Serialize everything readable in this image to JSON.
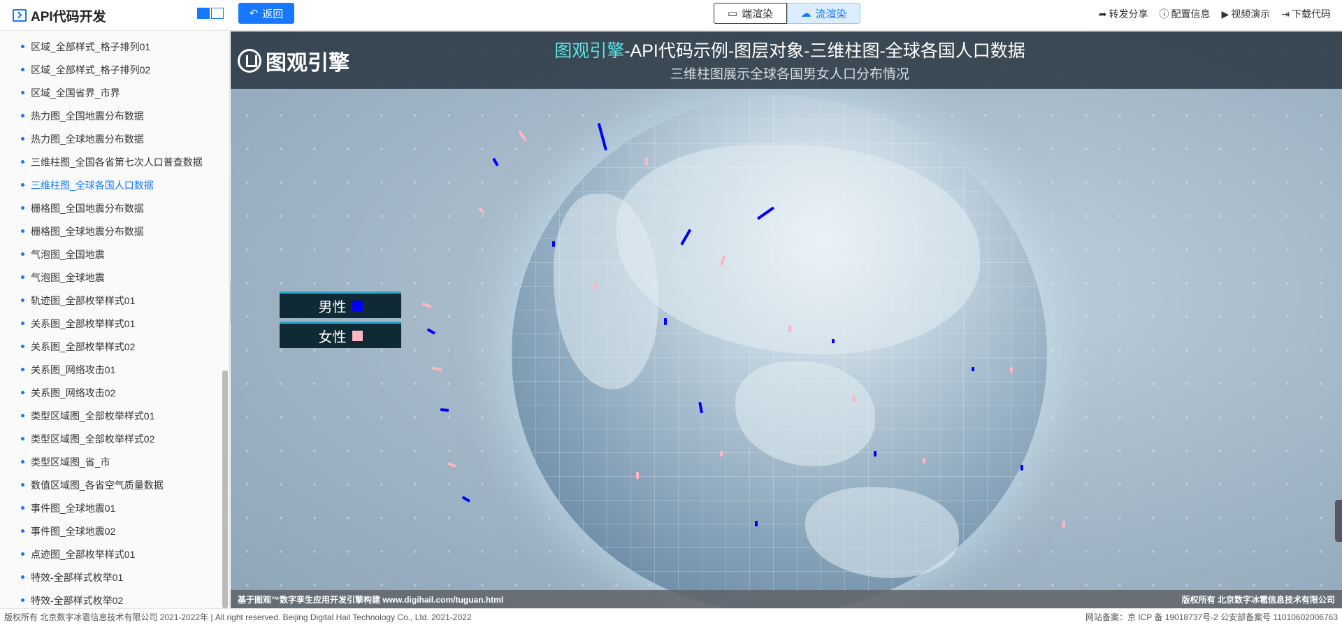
{
  "app": {
    "title": "API代码开发"
  },
  "toolbar": {
    "back_label": "返回",
    "render_options": [
      "端渲染",
      "流渲染"
    ],
    "active_render": "流渲染",
    "tools": [
      {
        "label": "转发分享",
        "icon": "share-icon"
      },
      {
        "label": "配置信息",
        "icon": "info-icon"
      },
      {
        "label": "视频演示",
        "icon": "play-icon"
      },
      {
        "label": "下载代码",
        "icon": "download-icon"
      }
    ]
  },
  "sidebar": {
    "active_index": 6,
    "items": [
      "区域_全部样式_格子排列01",
      "区域_全部样式_格子排列02",
      "区域_全国省界_市界",
      "热力图_全国地震分布数据",
      "热力图_全球地震分布数据",
      "三维柱图_全国各省第七次人口普查数据",
      "三维柱图_全球各国人口数据",
      "栅格图_全国地震分布数据",
      "栅格图_全球地震分布数据",
      "气泡图_全国地震",
      "气泡图_全球地震",
      "轨迹图_全部枚举样式01",
      "关系图_全部枚举样式01",
      "关系图_全部枚举样式02",
      "关系图_网络攻击01",
      "关系图_网络攻击02",
      "类型区域图_全部枚举样式01",
      "类型区域图_全部枚举样式02",
      "类型区域图_省_市",
      "数值区域图_各省空气质量数据",
      "事件图_全球地震01",
      "事件图_全球地震02",
      "点迹图_全部枚举样式01",
      "特效-全部样式枚举01",
      "特效-全部样式枚举02"
    ]
  },
  "stage": {
    "brand": "图观引擎",
    "title_highlight": "图观引擎",
    "title_rest": "-API代码示例-图层对象-三维柱图-全球各国人口数据",
    "subtitle": "三维柱图展示全球各国男女人口分布情况",
    "legend": [
      {
        "label": "男性",
        "color": "#0000ff"
      },
      {
        "label": "女性",
        "color": "#ffb6c1"
      }
    ],
    "footer_left": "基于图观™数字孪生应用开发引擎构建 www.digihail.com/tuguan.html",
    "footer_right": "版权所有 北京数字冰雹信息技术有限公司"
  },
  "footer": {
    "left": "版权所有 北京数字冰雹信息技术有限公司 2021-2022年 | All right reserved. Beijing Digital Hail Technology Co., Ltd. 2021-2022",
    "right": "网站备案：京 ICP 备 19018737号-2 公安部备案号 11010602006763"
  }
}
